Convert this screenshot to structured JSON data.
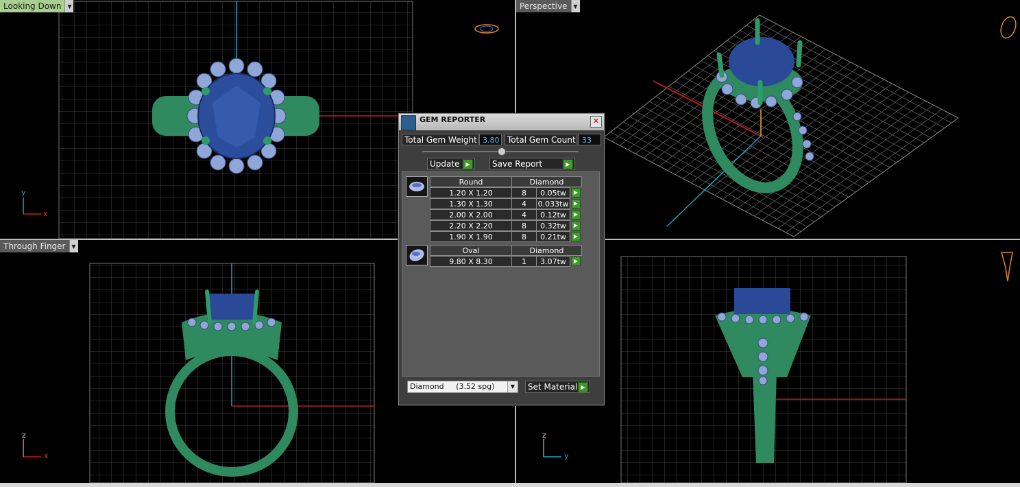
{
  "viewports": {
    "top_left": {
      "label": "Looking Down",
      "axis1": "y",
      "axis2": "x"
    },
    "top_right": {
      "label": "Perspective"
    },
    "bottom_left": {
      "label": "Through Finger",
      "axis1": "z",
      "axis2": "x"
    },
    "bottom_right": {
      "axis1": "z",
      "axis2": "y"
    }
  },
  "gem_reporter": {
    "title": "GEM REPORTER",
    "total_weight_label": "Total Gem Weight",
    "total_weight_value": "3.80",
    "total_count_label": "Total Gem Count",
    "total_count_value": "33",
    "update_label": "Update",
    "save_report_label": "Save Report",
    "groups": [
      {
        "shape": "Round",
        "material": "Diamond",
        "rows": [
          {
            "size": "1.20 X 1.20",
            "count": "8",
            "weight": "0.05tw"
          },
          {
            "size": "1.30 X 1.30",
            "count": "4",
            "weight": "0.033tw"
          },
          {
            "size": "2.00 X 2.00",
            "count": "4",
            "weight": "0.12tw"
          },
          {
            "size": "2.20 X 2.20",
            "count": "8",
            "weight": "0.32tw"
          },
          {
            "size": "1.90 X 1.90",
            "count": "8",
            "weight": "0.21tw"
          }
        ]
      },
      {
        "shape": "Oval",
        "material": "Diamond",
        "rows": [
          {
            "size": "9.80 X 8.30",
            "count": "1",
            "weight": "3.07tw"
          }
        ]
      }
    ],
    "material_select": "Diamond     (3.52 spg)",
    "set_material_label": "Set Material"
  },
  "colors": {
    "active_label": "#a8d08d",
    "metal": "#2f9a6a",
    "gem": "#2e4f9a",
    "accent_value": "#5dbbe8"
  }
}
